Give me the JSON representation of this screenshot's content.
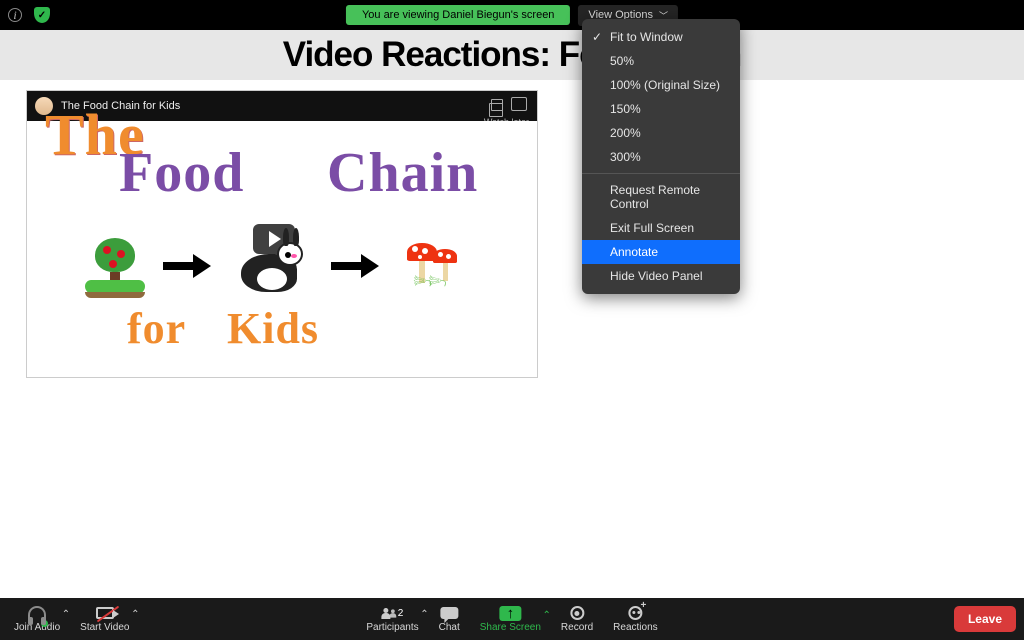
{
  "topbar": {
    "viewing_banner": "You are viewing Daniel Biegun's screen",
    "view_options_label": "View Options"
  },
  "page_title": "Video Reactions: Food Chain",
  "video": {
    "title": "The Food Chain for Kids",
    "watch_later_label": "Watch later",
    "word_the": "The",
    "word_food": "Food",
    "word_chain": "Chain",
    "word_for": "for",
    "word_kids": "Kids"
  },
  "dropdown": {
    "items": [
      {
        "label": "Fit to Window",
        "checked": true
      },
      {
        "label": "50%"
      },
      {
        "label": "100% (Original Size)"
      },
      {
        "label": "150%"
      },
      {
        "label": "200%"
      },
      {
        "label": "300%"
      }
    ],
    "request_remote": "Request Remote Control",
    "exit_fullscreen": "Exit Full Screen",
    "annotate": "Annotate",
    "hide_video_panel": "Hide Video Panel"
  },
  "bottombar": {
    "join_audio": "Join Audio",
    "start_video": "Start Video",
    "participants": "Participants",
    "participants_count": "2",
    "chat": "Chat",
    "share_screen": "Share Screen",
    "record": "Record",
    "reactions": "Reactions",
    "leave": "Leave"
  }
}
